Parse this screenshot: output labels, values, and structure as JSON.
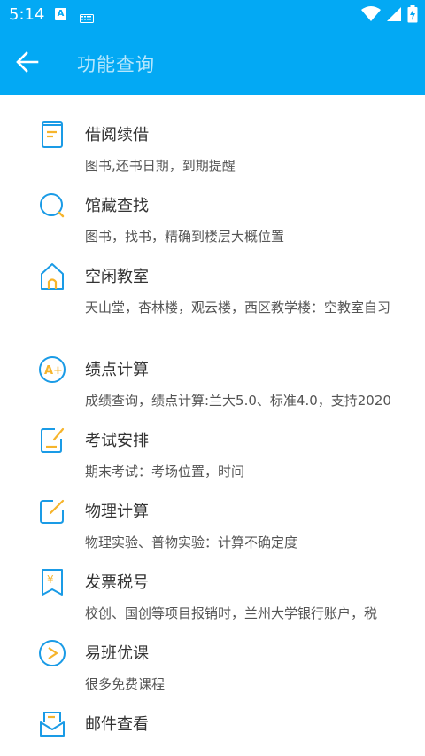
{
  "status_bar": {
    "time": "5:14",
    "notif_a": "A"
  },
  "app_bar": {
    "title": "功能查询"
  },
  "colors": {
    "primary": "#03a9f4",
    "icon": "#1a9be6"
  },
  "items": [
    {
      "icon": "book-icon",
      "title": "借阅续借",
      "subtitle": "图书,还书日期，到期提醒"
    },
    {
      "icon": "search-icon",
      "title": "馆藏查找",
      "subtitle": "图书，找书，精确到楼层大概位置"
    },
    {
      "icon": "home-icon",
      "title": "空闲教室",
      "subtitle": "天山堂，杏林楼，观云楼，西区教学楼：空教室自习"
    },
    {
      "icon": "grade-icon",
      "title": "绩点计算",
      "subtitle": "成绩查询，绩点计算:兰大5.0、标准4.0，支持2020"
    },
    {
      "icon": "exam-icon",
      "title": "考试安排",
      "subtitle": "期末考试：考场位置，时间"
    },
    {
      "icon": "edit-icon",
      "title": "物理计算",
      "subtitle": "物理实验、普物实验：计算不确定度"
    },
    {
      "icon": "invoice-icon",
      "title": "发票税号",
      "subtitle": "校创、国创等项目报销时，兰州大学银行账户，税"
    },
    {
      "icon": "play-icon",
      "title": "易班优课",
      "subtitle": "很多免费课程"
    },
    {
      "icon": "mail-icon",
      "title": "邮件查看",
      "subtitle": ""
    }
  ]
}
